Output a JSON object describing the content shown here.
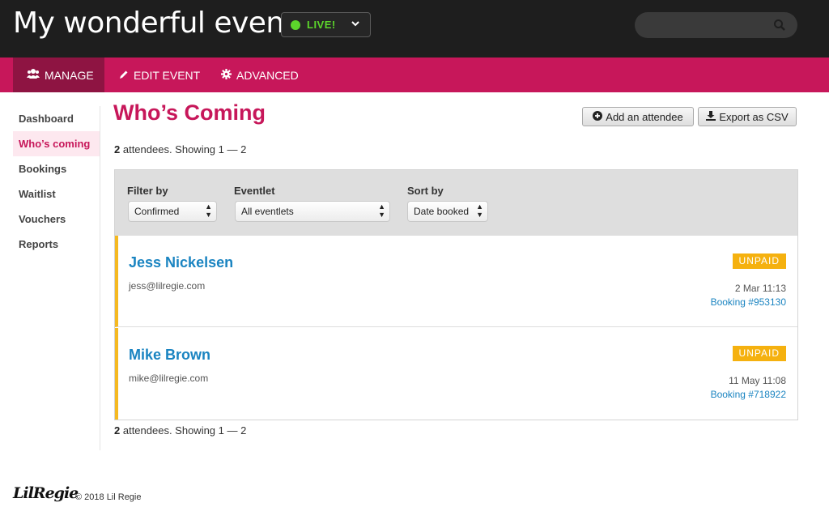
{
  "header": {
    "event_title": "My wonderful event",
    "live_label": "LIVE!",
    "search_placeholder": "",
    "colors": {
      "background": "#1e1e1e",
      "live_green": "#5cd62b"
    }
  },
  "nav": {
    "items": [
      {
        "label": "MANAGE",
        "icon": "users-icon",
        "active": true
      },
      {
        "label": "EDIT EVENT",
        "icon": "pencil-icon",
        "active": false
      },
      {
        "label": "ADVANCED",
        "icon": "gear-icon",
        "active": false
      }
    ],
    "colors": {
      "bar": "#c7175a",
      "active": "#8e1442"
    }
  },
  "sidebar": {
    "items": [
      {
        "label": "Dashboard",
        "active": false
      },
      {
        "label": "Who’s coming",
        "active": true
      },
      {
        "label": "Bookings",
        "active": false
      },
      {
        "label": "Waitlist",
        "active": false
      },
      {
        "label": "Vouchers",
        "active": false
      },
      {
        "label": "Reports",
        "active": false
      }
    ]
  },
  "main": {
    "title": "Who’s Coming",
    "add_button": "Add an attendee",
    "export_button": "Export as CSV",
    "summary": {
      "count": "2",
      "text": " attendees. Showing ",
      "range": "1 — 2"
    },
    "filters": {
      "filter_label": "Filter by",
      "filter_value": "Confirmed",
      "eventlet_label": "Eventlet",
      "eventlet_value": "All eventlets",
      "sort_label": "Sort by",
      "sort_value": "Date booked"
    },
    "attendees": [
      {
        "name": "Jess Nickelsen",
        "email": "jess@lilregie.com",
        "status": "UNPAID",
        "date": "2 Mar 11:13",
        "booking": "Booking #953130"
      },
      {
        "name": "Mike Brown",
        "email": "mike@lilregie.com",
        "status": "UNPAID",
        "date": "11 May 11:08",
        "booking": "Booking #718922"
      }
    ],
    "colors": {
      "accent": "#c7175a",
      "link": "#1a84c1",
      "unpaid": "#f5b10f"
    }
  },
  "footer": {
    "logo": "LilRegie",
    "copyright": "© 2018 Lil Regie"
  }
}
